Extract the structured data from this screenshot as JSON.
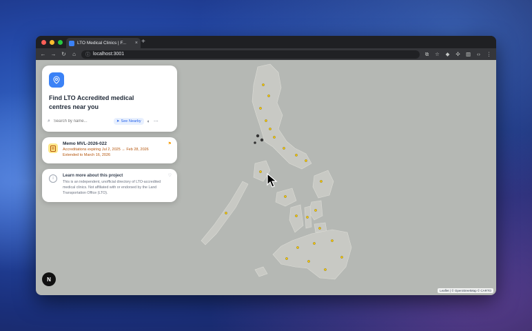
{
  "browser": {
    "tab_title": "LTO Medical Clinics | F...",
    "tab_close": "×",
    "new_tab": "+",
    "url": "localhost:3001"
  },
  "hero": {
    "title": "Find LTO Accredited medical centres near you",
    "search_placeholder": "Search by name...",
    "near_button": "See Nearby"
  },
  "memo": {
    "title": "Memo MVL-2026-022",
    "line1": "Accreditations expiring Jul 2, 2025 → Feb 28, 2026",
    "line2": "Extended to March 16, 2026"
  },
  "about": {
    "title": "Learn more about this project",
    "text": "This is an independent, unofficial directory of LTO-accredited medical clinics. Not affiliated with or endorsed by the Land Transportation Office (LTO)."
  },
  "map": {
    "attribution": "Leaflet | © OpenStreetMap © CARTO"
  },
  "n_badge": "N",
  "colors": {
    "accent": "#3b82f6",
    "memo_accent": "#b45309",
    "map_water": "#b5b8b4",
    "clinic_marker": "#f5c400"
  }
}
